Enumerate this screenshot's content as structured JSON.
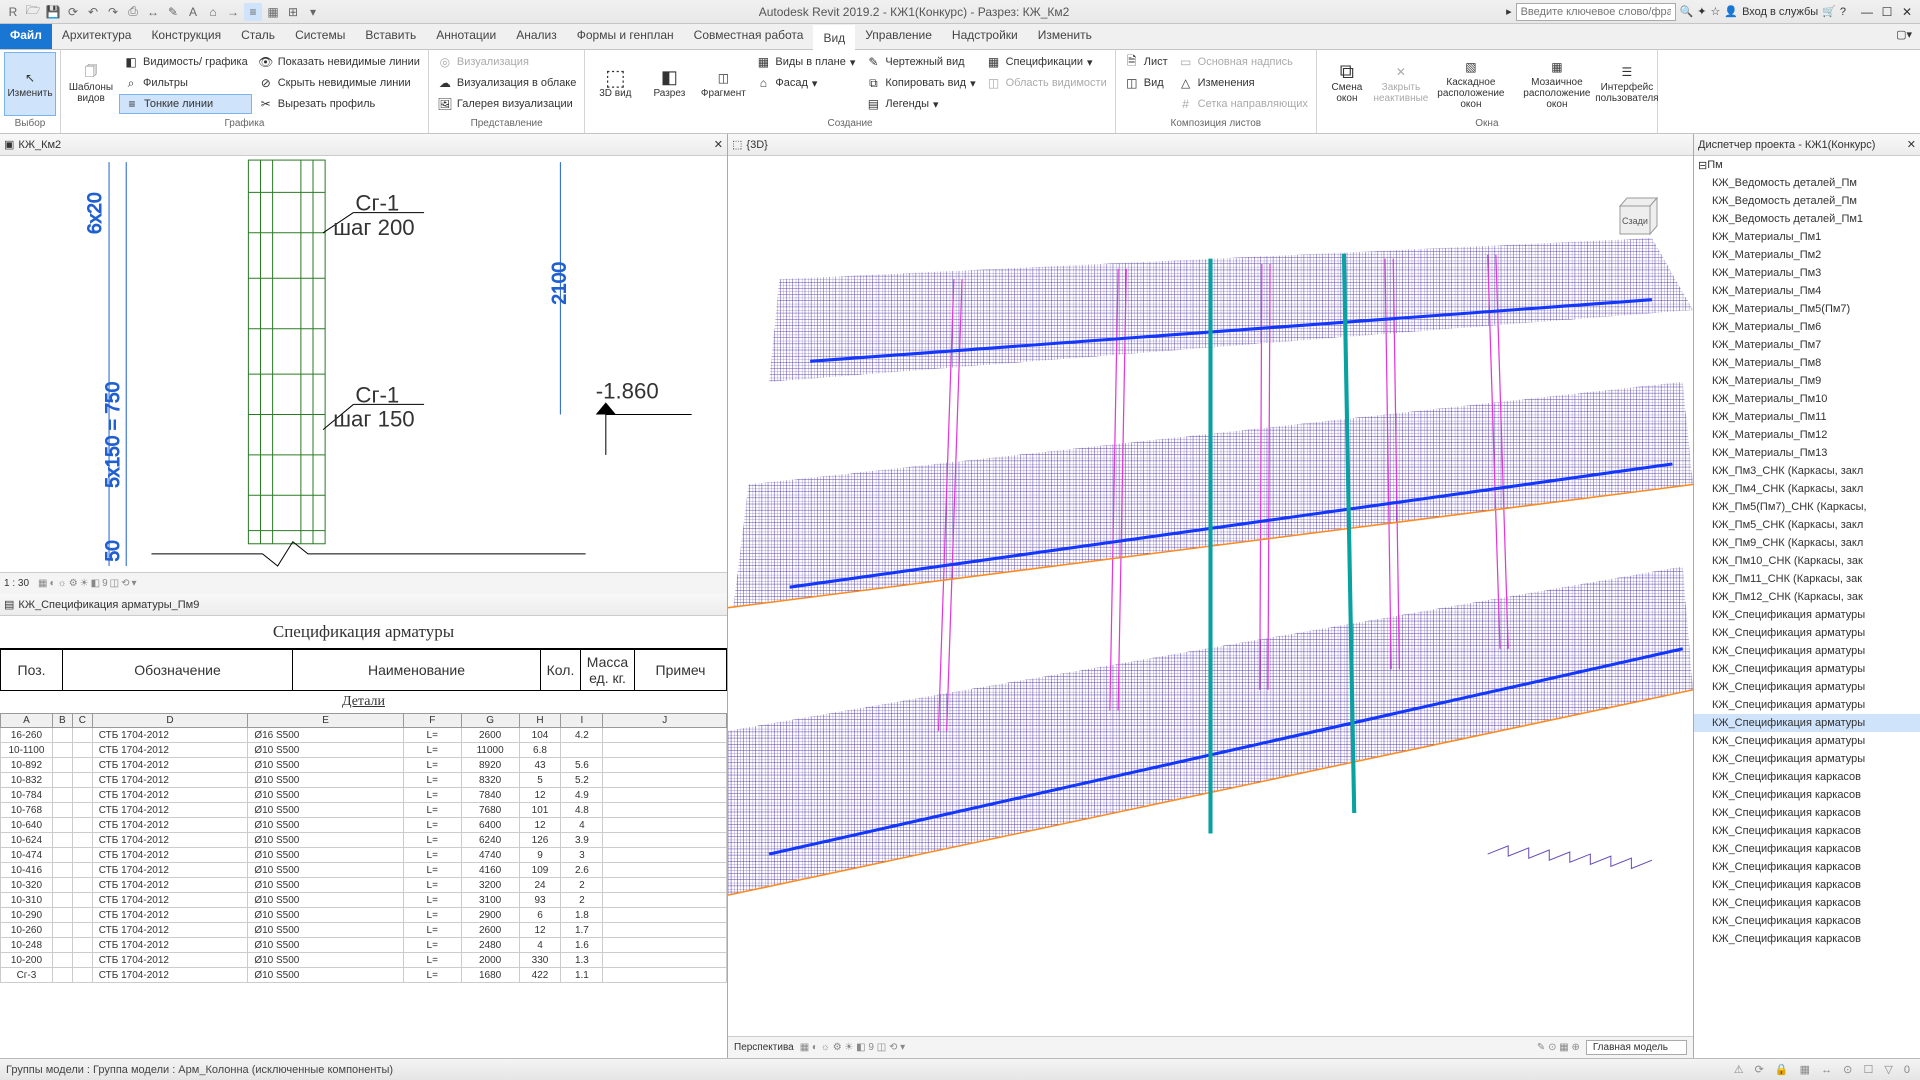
{
  "titlebar": {
    "title": "Autodesk Revit 2019.2 - КЖ1(Конкурс) - Разрез: КЖ_Км2",
    "search_placeholder": "Введите ключевое слово/фразу",
    "signin": "Вход в службы"
  },
  "tabs": {
    "file": "Файл",
    "items": [
      "Архитектура",
      "Конструкция",
      "Сталь",
      "Системы",
      "Вставить",
      "Аннотации",
      "Анализ",
      "Формы и генплан",
      "Совместная работа",
      "Вид",
      "Управление",
      "Надстройки",
      "Изменить"
    ],
    "active": "Вид"
  },
  "ribbon": {
    "modify": "Изменить",
    "select_group": "Выбор",
    "templates": "Шаблоны видов",
    "vg": "Видимость/ графика",
    "filters": "Фильтры",
    "thin_lines": "Тонкие линии",
    "show_hidden": "Показать невидимые линии",
    "hide_hidden": "Скрыть невидимые линии",
    "cut_profile": "Вырезать профиль",
    "graphics_group": "Графика",
    "render": "Визуализация",
    "render_cloud": "Визуализация в облаке",
    "render_gallery": "Галерея визуализации",
    "presentation_group": "Представление",
    "view3d": "3D вид",
    "section": "Разрез",
    "fragment": "Фрагмент",
    "plan_views": "Виды в плане",
    "facade": "Фасад",
    "drafting": "Чертежный вид",
    "dup": "Копировать вид",
    "legends": "Легенды",
    "schedules": "Спецификации",
    "scope": "Область видимости",
    "create_group": "Создание",
    "sheet": "Лист",
    "view_btn": "Вид",
    "titleblock": "Основная надпись",
    "revisions": "Изменения",
    "guides": "Сетка направляющих",
    "sheetcomp_group": "Композиция листов",
    "switch": "Смена окон",
    "close": "Закрыть неактивные",
    "cascade": "Каскадное расположение окон",
    "tile": "Мозаичное расположение окон",
    "ui": "Интерфейс пользователя",
    "windows_group": "Окна"
  },
  "views": {
    "section_tab": "КЖ_Км2",
    "d3_tab": "{3D}",
    "browser_tab": "Диспетчер проекта - КЖ1(Конкурс)",
    "spec_tab": "КЖ_Спецификация арматуры_Пм9"
  },
  "section": {
    "scale": "1 : 30",
    "dim1": "6x20",
    "dim2": "2100",
    "dim3": "5x150 = 750",
    "dim4": "50",
    "label1_a": "Сг-1",
    "label1_b": "шаг 200",
    "label2_a": "Сг-1",
    "label2_b": "шаг 150",
    "elev": "-1.860"
  },
  "spec": {
    "title": "Спецификация арматуры",
    "h_pos": "Поз.",
    "h_des": "Обозначение",
    "h_name": "Наименование",
    "h_qty": "Кол.",
    "h_mass1": "Масса",
    "h_mass2": "ед. кг.",
    "h_note": "Примеч",
    "sub": "Детали",
    "cols": [
      "A",
      "B",
      "C",
      "D",
      "E",
      "F",
      "G",
      "H",
      "I",
      "J"
    ],
    "rows": [
      {
        "a": "16-260",
        "d": "СТБ 1704-2012",
        "e": "Ø16 S500",
        "f": "L=",
        "g": "2600",
        "h": "104",
        "i": "4.2"
      },
      {
        "a": "10-1100",
        "d": "СТБ 1704-2012",
        "e": "Ø10 S500",
        "f": "L=",
        "g": "11000",
        "h": "6.8",
        "i": ""
      },
      {
        "a": "10-892",
        "d": "СТБ 1704-2012",
        "e": "Ø10 S500",
        "f": "L=",
        "g": "8920",
        "h": "43",
        "i": "5.6"
      },
      {
        "a": "10-832",
        "d": "СТБ 1704-2012",
        "e": "Ø10 S500",
        "f": "L=",
        "g": "8320",
        "h": "5",
        "i": "5.2"
      },
      {
        "a": "10-784",
        "d": "СТБ 1704-2012",
        "e": "Ø10 S500",
        "f": "L=",
        "g": "7840",
        "h": "12",
        "i": "4.9"
      },
      {
        "a": "10-768",
        "d": "СТБ 1704-2012",
        "e": "Ø10 S500",
        "f": "L=",
        "g": "7680",
        "h": "101",
        "i": "4.8"
      },
      {
        "a": "10-640",
        "d": "СТБ 1704-2012",
        "e": "Ø10 S500",
        "f": "L=",
        "g": "6400",
        "h": "12",
        "i": "4"
      },
      {
        "a": "10-624",
        "d": "СТБ 1704-2012",
        "e": "Ø10 S500",
        "f": "L=",
        "g": "6240",
        "h": "126",
        "i": "3.9"
      },
      {
        "a": "10-474",
        "d": "СТБ 1704-2012",
        "e": "Ø10 S500",
        "f": "L=",
        "g": "4740",
        "h": "9",
        "i": "3"
      },
      {
        "a": "10-416",
        "d": "СТБ 1704-2012",
        "e": "Ø10 S500",
        "f": "L=",
        "g": "4160",
        "h": "109",
        "i": "2.6"
      },
      {
        "a": "10-320",
        "d": "СТБ 1704-2012",
        "e": "Ø10 S500",
        "f": "L=",
        "g": "3200",
        "h": "24",
        "i": "2"
      },
      {
        "a": "10-310",
        "d": "СТБ 1704-2012",
        "e": "Ø10 S500",
        "f": "L=",
        "g": "3100",
        "h": "93",
        "i": "2"
      },
      {
        "a": "10-290",
        "d": "СТБ 1704-2012",
        "e": "Ø10 S500",
        "f": "L=",
        "g": "2900",
        "h": "6",
        "i": "1.8"
      },
      {
        "a": "10-260",
        "d": "СТБ 1704-2012",
        "e": "Ø10 S500",
        "f": "L=",
        "g": "2600",
        "h": "12",
        "i": "1.7"
      },
      {
        "a": "10-248",
        "d": "СТБ 1704-2012",
        "e": "Ø10 S500",
        "f": "L=",
        "g": "2480",
        "h": "4",
        "i": "1.6"
      },
      {
        "a": "10-200",
        "d": "СТБ 1704-2012",
        "e": "Ø10 S500",
        "f": "L=",
        "g": "2000",
        "h": "330",
        "i": "1.3"
      },
      {
        "a": "Сг-3",
        "d": "СТБ 1704-2012",
        "e": "Ø10 S500",
        "f": "L=",
        "g": "1680",
        "h": "422",
        "i": "1.1"
      }
    ]
  },
  "view3d": {
    "mode": "Перспектива",
    "model": "Главная модель",
    "cube": "Сзади"
  },
  "browser": {
    "root": "Пм",
    "items": [
      "КЖ_Ведомость деталей_Пм",
      "КЖ_Ведомость деталей_Пм",
      "КЖ_Ведомость деталей_Пм1",
      "КЖ_Материалы_Пм1",
      "КЖ_Материалы_Пм2",
      "КЖ_Материалы_Пм3",
      "КЖ_Материалы_Пм4",
      "КЖ_Материалы_Пм5(Пм7)",
      "КЖ_Материалы_Пм6",
      "КЖ_Материалы_Пм7",
      "КЖ_Материалы_Пм8",
      "КЖ_Материалы_Пм9",
      "КЖ_Материалы_Пм10",
      "КЖ_Материалы_Пм11",
      "КЖ_Материалы_Пм12",
      "КЖ_Материалы_Пм13",
      "КЖ_Пм3_СНК (Каркасы, закл",
      "КЖ_Пм4_СНК (Каркасы, закл",
      "КЖ_Пм5(Пм7)_СНК (Каркасы,",
      "КЖ_Пм5_СНК (Каркасы, закл",
      "КЖ_Пм9_СНК (Каркасы, закл",
      "КЖ_Пм10_СНК (Каркасы, зак",
      "КЖ_Пм11_СНК (Каркасы, зак",
      "КЖ_Пм12_СНК (Каркасы, зак",
      "КЖ_Спецификация арматуры",
      "КЖ_Спецификация арматуры",
      "КЖ_Спецификация арматуры",
      "КЖ_Спецификация арматуры",
      "КЖ_Спецификация арматуры",
      "КЖ_Спецификация арматуры",
      "КЖ_Спецификация арматуры",
      "КЖ_Спецификация арматуры",
      "КЖ_Спецификация арматуры",
      "КЖ_Спецификация каркасов",
      "КЖ_Спецификация каркасов",
      "КЖ_Спецификация каркасов",
      "КЖ_Спецификация каркасов",
      "КЖ_Спецификация каркасов",
      "КЖ_Спецификация каркасов",
      "КЖ_Спецификация каркасов",
      "КЖ_Спецификация каркасов",
      "КЖ_Спецификация каркасов",
      "КЖ_Спецификация каркасов"
    ],
    "selected": 30
  },
  "statusbar": {
    "msg": "Группы модели : Группа модели : Арм_Колонна (исключенные компоненты)"
  }
}
